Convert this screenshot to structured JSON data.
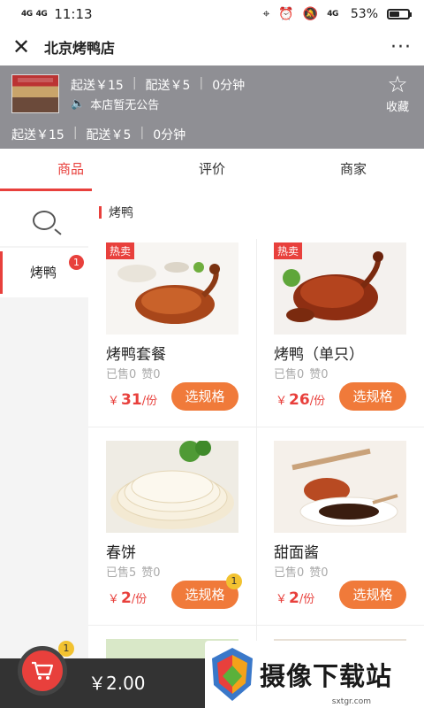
{
  "status_bar": {
    "signal_1": "4G",
    "signal_2": "4G",
    "time": "11:13",
    "network": "4G",
    "battery": "53%",
    "battery_level": 0.53
  },
  "title_bar": {
    "close_icon": "close-icon",
    "title": "北京烤鸭店",
    "more_icon": "more-icon"
  },
  "shop": {
    "min_order": "起送￥15",
    "delivery_fee": "配送￥5",
    "delivery_time": "0分钟",
    "notice": "本店暂无公告",
    "favorite_label": "收藏"
  },
  "tabs": [
    {
      "label": "商品",
      "active": true
    },
    {
      "label": "评价",
      "active": false
    },
    {
      "label": "商家",
      "active": false
    }
  ],
  "categories": [
    {
      "label": "烤鸭",
      "badge": "1"
    }
  ],
  "section_title": "烤鸭",
  "products": [
    {
      "tag": "热卖",
      "name": "烤鸭套餐",
      "sold": "已售0",
      "likes": "赞0",
      "currency": "￥",
      "price": "31",
      "unit": "/份",
      "button": "选规格",
      "badge": ""
    },
    {
      "tag": "热卖",
      "name": "烤鸭（单只）",
      "sold": "已售0",
      "likes": "赞0",
      "currency": "￥",
      "price": "26",
      "unit": "/份",
      "button": "选规格",
      "badge": ""
    },
    {
      "tag": "",
      "name": "春饼",
      "sold": "已售5",
      "likes": "赞0",
      "currency": "￥",
      "price": "2",
      "unit": "/份",
      "button": "选规格",
      "badge": "1"
    },
    {
      "tag": "",
      "name": "甜面酱",
      "sold": "已售0",
      "likes": "赞0",
      "currency": "￥",
      "price": "2",
      "unit": "/份",
      "button": "选规格",
      "badge": ""
    }
  ],
  "cart": {
    "count": "1",
    "total": "￥2.00"
  },
  "watermark": {
    "text": "摄像下载站",
    "url": "sxtgr.com"
  },
  "colors": {
    "accent": "#e8403c",
    "button": "#f07a3a",
    "header": "#8f8f94",
    "cart_bar": "#333333"
  }
}
